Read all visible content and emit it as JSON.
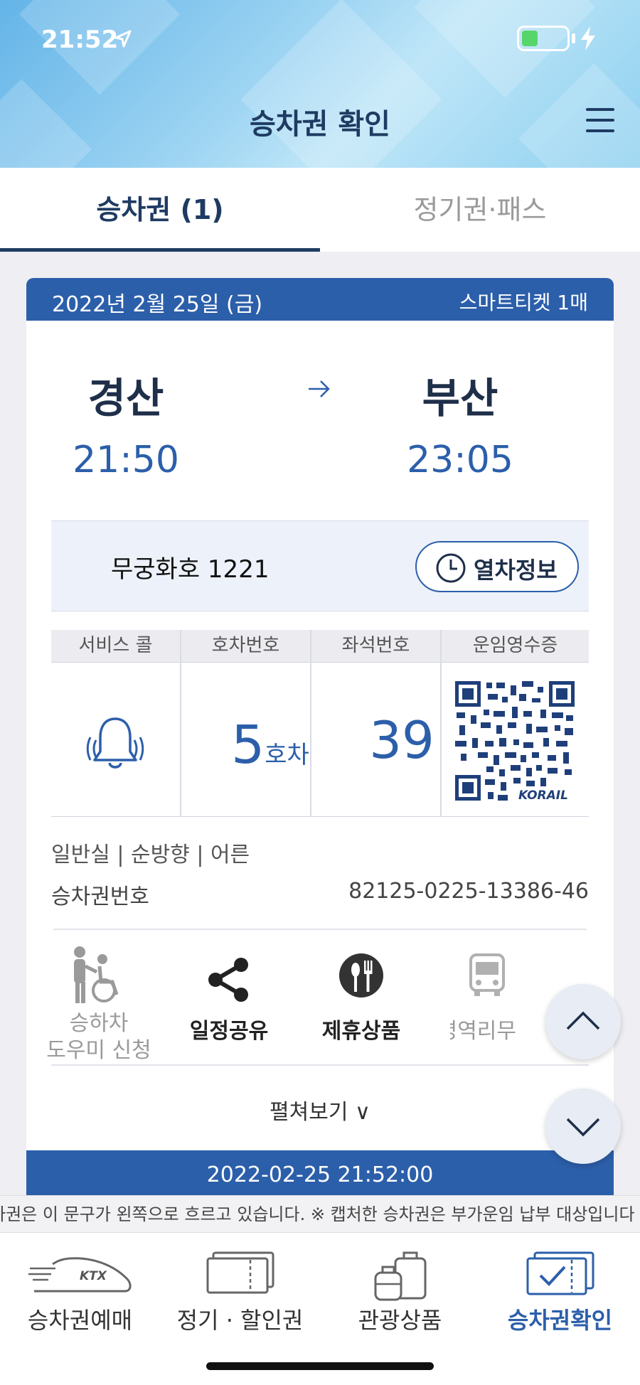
{
  "status_bar": {
    "time": "21:52"
  },
  "header": {
    "title": "승차권 확인"
  },
  "tabs": [
    {
      "label": "승차권 (1)",
      "active": true
    },
    {
      "label": "정기권·패스",
      "active": false
    }
  ],
  "ticket": {
    "date": "2022년 2월 25일 (금)",
    "ticket_type": "스마트티켓 1매",
    "departure": {
      "station": "경산",
      "time": "21:50"
    },
    "arrival": {
      "station": "부산",
      "time": "23:05"
    },
    "train": "무궁화호 1221",
    "train_info_button": "열차정보",
    "grid_headers": [
      "서비스 콜",
      "호차번호",
      "좌석번호",
      "운임영수증"
    ],
    "car_number": "5",
    "car_suffix": "호차",
    "seat_number": "39",
    "qr_brand": "KORAIL",
    "seat_info": "일반실 | 순방향 | 어른",
    "ticket_number_label": "승차권번호",
    "ticket_number": "82125-0225-13386-46",
    "services": [
      {
        "line1": "승하차",
        "line2": "도우미 신청",
        "enabled": false
      },
      {
        "line1": "일정공유",
        "enabled": true
      },
      {
        "line1": "제휴상품",
        "enabled": true
      },
      {
        "line1": "광명역리무",
        "enabled": false
      }
    ],
    "expand_label": "펼쳐보기 ∨",
    "issued_at": "2022-02-25 21:52:00"
  },
  "marquee": "차권은 이 문구가 왼쪽으로 흐르고 있습니다. ※ 캡처한 승차권은 부가운임 납부 대상입니다",
  "bottom_nav": [
    {
      "label": "승차권예매",
      "active": false
    },
    {
      "label": "정기 · 할인권",
      "active": false
    },
    {
      "label": "관광상품",
      "active": false
    },
    {
      "label": "승차권확인",
      "active": true
    }
  ],
  "colors": {
    "primary": "#2c5faa",
    "dark_navy": "#1f3b62",
    "disabled": "#9a9a9a"
  }
}
